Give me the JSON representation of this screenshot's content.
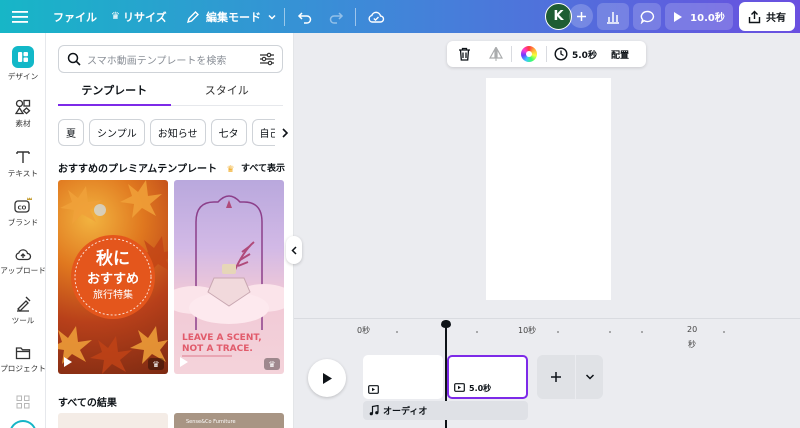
{
  "topbar": {
    "file": "ファイル",
    "resize": "リサイズ",
    "edit_mode": "編集モード",
    "avatar_initial": "K",
    "play_duration": "10.0秒",
    "share": "共有"
  },
  "rail": {
    "design": "デザイン",
    "elements": "素材",
    "text": "テキスト",
    "brand": "ブランド",
    "uploads": "アップロード",
    "tools": "ツール",
    "projects": "プロジェクト"
  },
  "panel": {
    "search_placeholder": "スマホ動画テンプレートを検索",
    "tabs": [
      "テンプレート",
      "スタイル"
    ],
    "chips": [
      "夏",
      "シンプル",
      "お知らせ",
      "七タ",
      "自己"
    ],
    "premium_title": "おすすめのプレミアムテンプレート",
    "see_all": "すべて表示",
    "all_results": "すべての結果",
    "template1": {
      "line1": "秋に",
      "line2": "おすすめ",
      "line3": "旅行特集"
    },
    "template2": {
      "line1": "LEAVE A SCENT,",
      "line2": "NOT A TRACE."
    },
    "result2_caption": "Sense&Co Furniture"
  },
  "context_toolbar": {
    "duration": "5.0秒",
    "position": "配置"
  },
  "timeline": {
    "ticks": [
      "0秒",
      "10秒",
      "20",
      "秒"
    ],
    "clip_duration": "5.0秒",
    "audio_label": "オーディオ"
  },
  "colors": {
    "accent": "#7d2ae8",
    "avatar": "#1f5d33"
  }
}
